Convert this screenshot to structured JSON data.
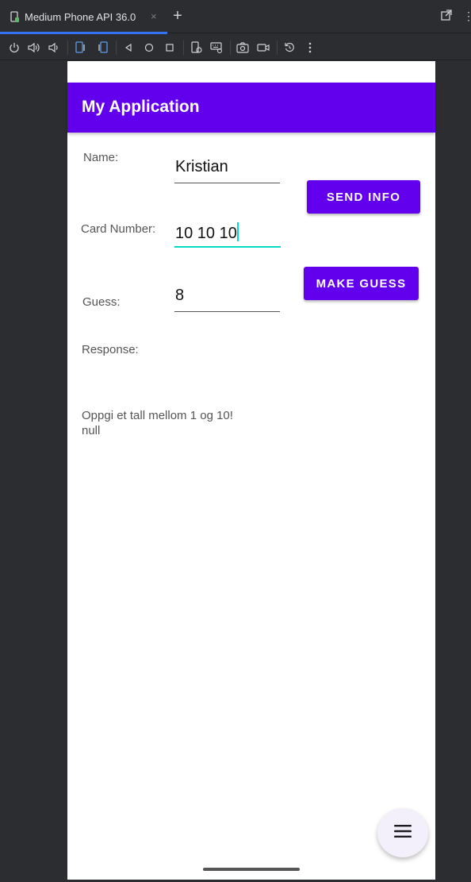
{
  "ide": {
    "tab_title": "Medium Phone API 36.0",
    "tab_close": "×",
    "add_tab": "+",
    "more": "⋮",
    "accent": "#3574f0"
  },
  "toolbar": {
    "icons": [
      "power-icon",
      "volume-up-icon",
      "volume-down-icon",
      "rotate-left-icon",
      "rotate-right-icon",
      "back-icon",
      "home-icon",
      "overview-icon",
      "snapshot-icon",
      "keyboard-icon",
      "screenshot-icon",
      "record-icon",
      "reset-icon",
      "more-icon"
    ]
  },
  "app": {
    "title": "My Application",
    "primary_color": "#6200ee",
    "accent_color": "#03dac5",
    "name_label": "Name:",
    "name_value": "Kristian",
    "card_label": "Card Number:",
    "card_value": "10 10 10",
    "guess_label": "Guess:",
    "guess_value": "8",
    "send_button": "SEND INFO",
    "guess_button": "MAKE GUESS",
    "response_label": "Response:",
    "response_line1": "Oppgi et tall mellom 1 og 10!",
    "response_line2": "null"
  }
}
